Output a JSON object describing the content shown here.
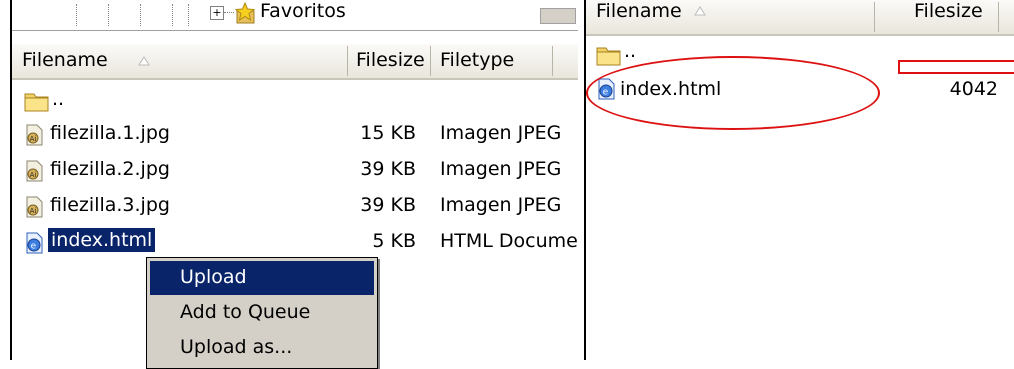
{
  "tree": {
    "expand_symbol": "+",
    "label": "Favoritos"
  },
  "local": {
    "columns": {
      "filename": "Filename",
      "filesize": "Filesize",
      "filetype": "Filetype"
    },
    "parent_label": "..",
    "files": [
      {
        "name": "filezilla.1.jpg",
        "size": "15 KB",
        "type": "Imagen JPEG",
        "icon": "jpeg-file-icon"
      },
      {
        "name": "filezilla.2.jpg",
        "size": "39 KB",
        "type": "Imagen JPEG",
        "icon": "jpeg-file-icon"
      },
      {
        "name": "filezilla.3.jpg",
        "size": "39 KB",
        "type": "Imagen JPEG",
        "icon": "jpeg-file-icon"
      },
      {
        "name": "index.html",
        "size": "5 KB",
        "type": "HTML Documer",
        "icon": "html-file-icon"
      }
    ]
  },
  "context_menu": {
    "items": [
      "Upload",
      "Add to Queue",
      "Upload as..."
    ],
    "highlighted": "Upload"
  },
  "remote": {
    "columns": {
      "filename": "Filename",
      "filesize": "Filesize"
    },
    "parent_label": "..",
    "files": [
      {
        "name": "index.html",
        "size": "4042",
        "icon": "html-file-icon"
      }
    ]
  },
  "colors": {
    "selection": "#0a246a",
    "annotation": "#dd1111",
    "menu_bg": "#d4d0c8"
  }
}
